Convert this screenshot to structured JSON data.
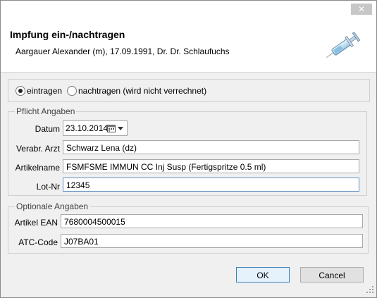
{
  "window": {
    "close_label": "✕"
  },
  "header": {
    "title": "Impfung ein-/nachtragen",
    "patient": "Aargauer Alexander (m), 17.09.1991, Dr. Dr. Schlaufuchs",
    "icon": "syringe-icon"
  },
  "mode": {
    "option_enter": "eintragen",
    "option_backdate": "nachtragen (wird nicht verrechnet)",
    "selected": "eintragen"
  },
  "required": {
    "title": "Pflicht Angaben",
    "date_label": "Datum",
    "date_value": "23.10.2014",
    "doctor_label": "Verabr. Arzt",
    "doctor_value": "Schwarz Lena (dz)",
    "article_label": "Artikelname",
    "article_value": "FSMFSME IMMUN CC Inj Susp (Fertigspritze 0.5 ml)",
    "lot_label": "Lot-Nr",
    "lot_value": "12345"
  },
  "optional": {
    "title": "Optionale Angaben",
    "ean_label": "Artikel EAN",
    "ean_value": "7680004500015",
    "atc_label": "ATC-Code",
    "atc_value": "J07BA01"
  },
  "buttons": {
    "ok": "OK",
    "cancel": "Cancel"
  }
}
